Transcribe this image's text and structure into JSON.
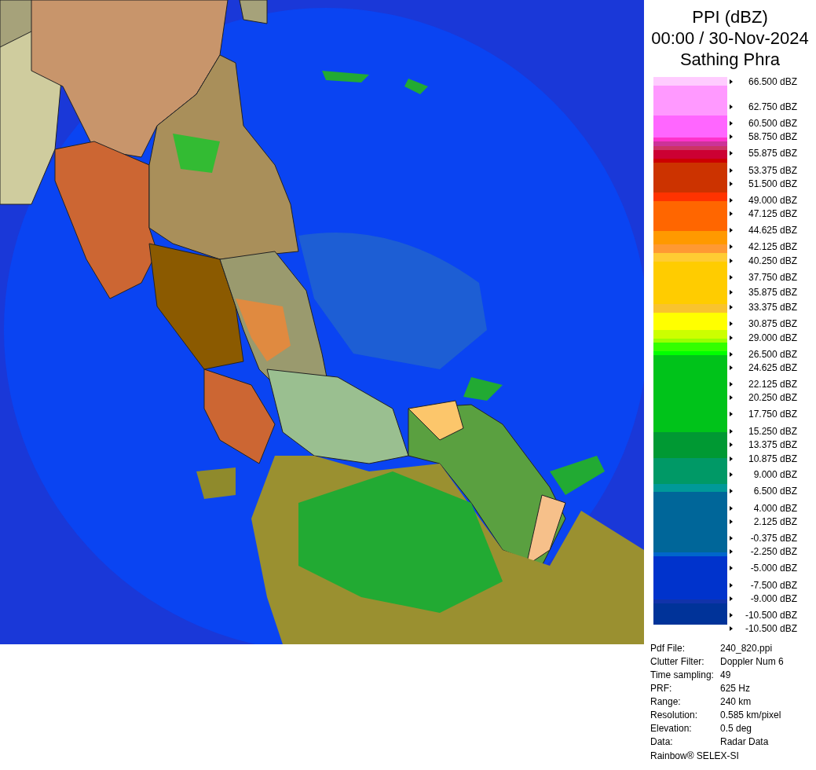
{
  "title": {
    "product": "PPI (dBZ)",
    "datetime": "00:00 / 30-Nov-2024",
    "site": "Sathing Phra"
  },
  "legend": {
    "labels": [
      "66.500 dBZ",
      "62.750 dBZ",
      "60.500 dBZ",
      "58.750 dBZ",
      "55.875 dBZ",
      "53.375 dBZ",
      "51.500 dBZ",
      "49.000 dBZ",
      "47.125 dBZ",
      "44.625 dBZ",
      "42.125 dBZ",
      "40.250 dBZ",
      "37.750 dBZ",
      "35.875 dBZ",
      "33.375 dBZ",
      "30.875 dBZ",
      "29.000 dBZ",
      "26.500 dBZ",
      "24.625 dBZ",
      "22.125 dBZ",
      "20.250 dBZ",
      "17.750 dBZ",
      "15.250 dBZ",
      "13.375 dBZ",
      "10.875 dBZ",
      "9.000 dBZ",
      "6.500 dBZ",
      "4.000 dBZ",
      "2.125 dBZ",
      "-0.375 dBZ",
      "-2.250 dBZ",
      "-5.000 dBZ",
      "-7.500 dBZ",
      "-9.000 dBZ",
      "-10.500 dBZ",
      "-10.500 dBZ"
    ],
    "bands": [
      {
        "color": "#ffccff"
      },
      {
        "color": "#ff99ff"
      },
      {
        "color": "#ff66ff"
      },
      {
        "color": "#ff33cc"
      },
      {
        "color": "#cc3399"
      },
      {
        "color": "#cc3366"
      },
      {
        "color": "#cc0033"
      },
      {
        "color": "#cc0000"
      },
      {
        "color": "#cc3300"
      },
      {
        "color": "#ff3300"
      },
      {
        "color": "#ff6600"
      },
      {
        "color": "#ff9900"
      },
      {
        "color": "#ff9933"
      },
      {
        "color": "#ffcc33"
      },
      {
        "color": "#ffcc00"
      },
      {
        "color": "#f9c32e"
      },
      {
        "color": "#ffff00"
      },
      {
        "color": "#ccff00"
      },
      {
        "color": "#99ff00"
      },
      {
        "color": "#33ff00"
      },
      {
        "color": "#00ff00"
      },
      {
        "color": "#00c31a"
      },
      {
        "color": "#009933"
      },
      {
        "color": "#009966"
      },
      {
        "color": "#009999"
      },
      {
        "color": "#006699"
      },
      {
        "color": "#0066cc"
      },
      {
        "color": "#0033cc"
      },
      {
        "color": "#1133aa"
      },
      {
        "color": "#003399"
      }
    ]
  },
  "info": [
    {
      "label": "Pdf File:",
      "value": "240_820.ppi"
    },
    {
      "label": "Clutter Filter:",
      "value": "Doppler Num 6"
    },
    {
      "label": "Time sampling:",
      "value": "49"
    },
    {
      "label": "PRF:",
      "value": "625 Hz"
    },
    {
      "label": "Range:",
      "value": "240 km"
    },
    {
      "label": "Resolution:",
      "value": "0.585 km/pixel"
    },
    {
      "label": "Elevation:",
      "value": "0.5 deg"
    },
    {
      "label": "Data:",
      "value": "Radar Data"
    }
  ],
  "footer": "Rainbow® SELEX-SI"
}
